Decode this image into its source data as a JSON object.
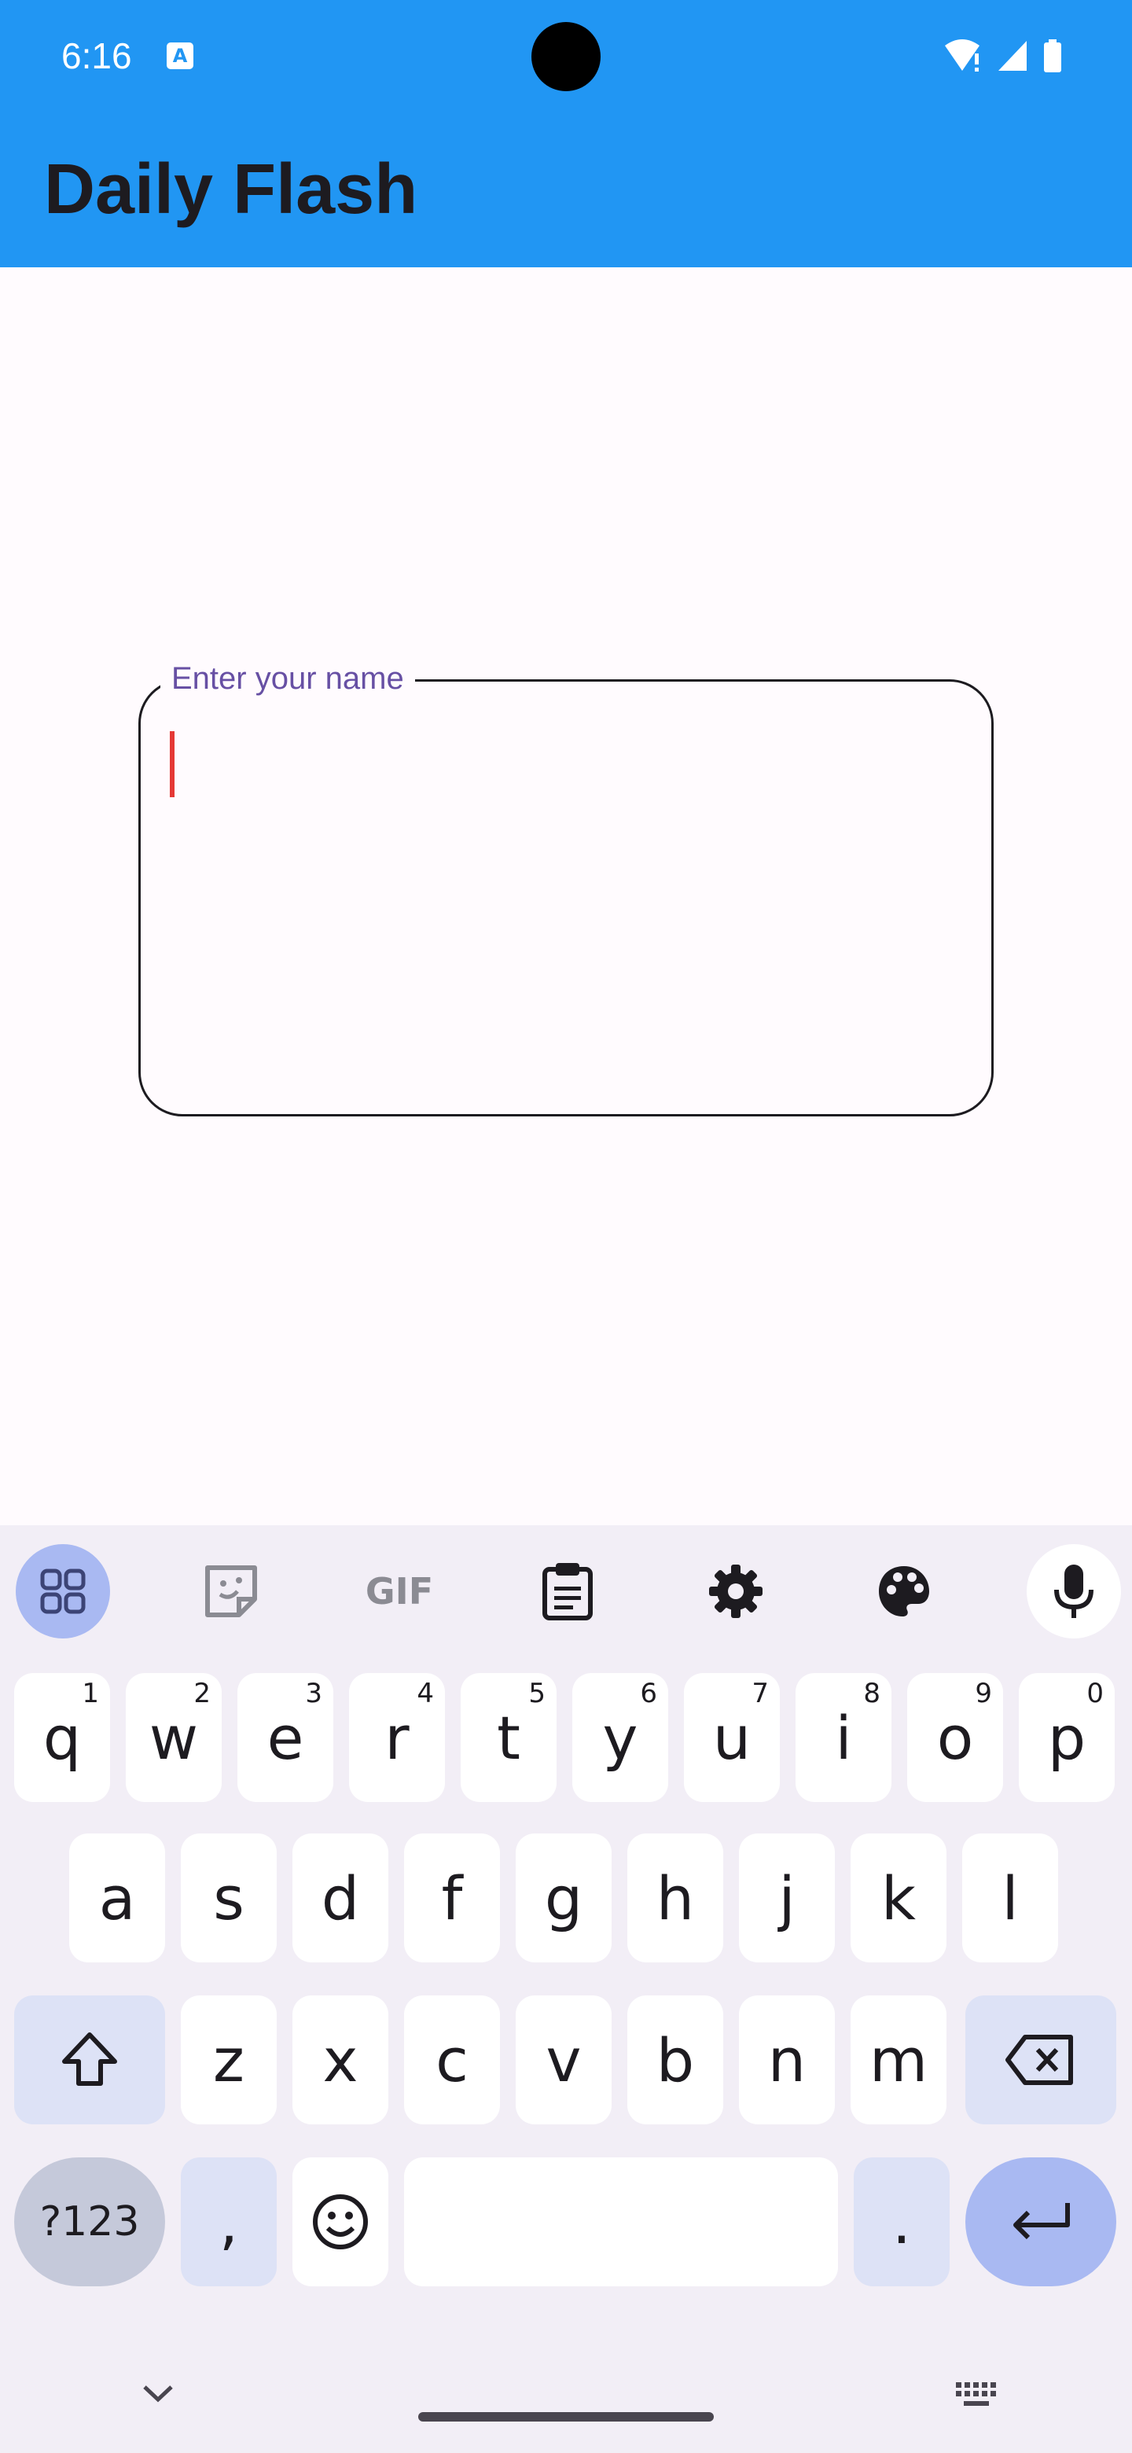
{
  "status_bar": {
    "time": "6:16",
    "notification_icon": "A"
  },
  "app_bar": {
    "title": "Daily Flash"
  },
  "name_field": {
    "label": "Enter your name",
    "value": ""
  },
  "keyboard": {
    "toolbar": [
      "apps-grid-icon",
      "sticker-icon",
      "gif-icon",
      "clipboard-icon",
      "settings-icon",
      "palette-icon",
      "mic-icon"
    ],
    "gif_label": "GIF",
    "row1": [
      {
        "key": "q",
        "hint": "1"
      },
      {
        "key": "w",
        "hint": "2"
      },
      {
        "key": "e",
        "hint": "3"
      },
      {
        "key": "r",
        "hint": "4"
      },
      {
        "key": "t",
        "hint": "5"
      },
      {
        "key": "y",
        "hint": "6"
      },
      {
        "key": "u",
        "hint": "7"
      },
      {
        "key": "i",
        "hint": "8"
      },
      {
        "key": "o",
        "hint": "9"
      },
      {
        "key": "p",
        "hint": "0"
      }
    ],
    "row2": [
      "a",
      "s",
      "d",
      "f",
      "g",
      "h",
      "j",
      "k",
      "l"
    ],
    "row3": [
      "z",
      "x",
      "c",
      "v",
      "b",
      "n",
      "m"
    ],
    "symbols_label": "?123",
    "comma_label": ",",
    "period_label": ".",
    "colors": {
      "accent": "#2196f3",
      "toolbar_active": "#a9b9f2",
      "func_key": "#dde2f6",
      "key": "#ffffff"
    }
  }
}
